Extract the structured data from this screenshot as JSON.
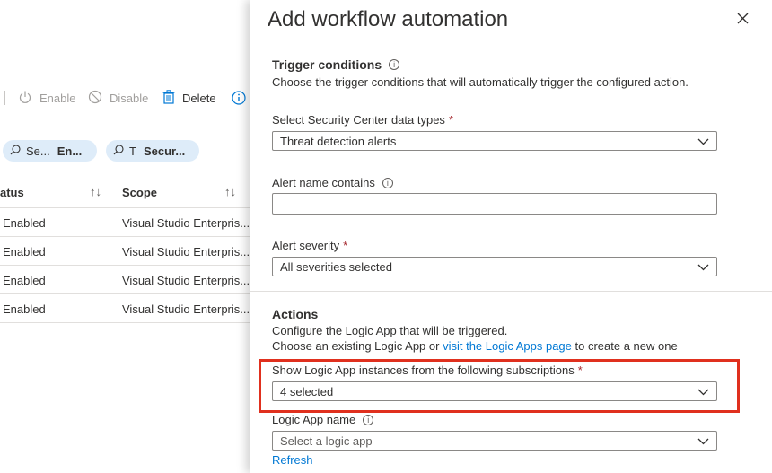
{
  "toolbar": {
    "enable_label": "Enable",
    "disable_label": "Disable",
    "delete_label": "Delete"
  },
  "filters": [
    {
      "label": "Se...",
      "value": "En..."
    },
    {
      "label": "T",
      "value": "Secur..."
    }
  ],
  "table": {
    "columns": [
      "atus",
      "Scope"
    ],
    "rows": [
      {
        "status": "Enabled",
        "scope": "Visual Studio Enterpris..."
      },
      {
        "status": "Enabled",
        "scope": "Visual Studio Enterpris..."
      },
      {
        "status": "Enabled",
        "scope": "Visual Studio Enterpris..."
      },
      {
        "status": "Enabled",
        "scope": "Visual Studio Enterpris..."
      }
    ]
  },
  "blade": {
    "title": "Add workflow automation",
    "trigger": {
      "title": "Trigger conditions",
      "description": "Choose the trigger conditions that will automatically trigger the configured action.",
      "data_types_label": "Select Security Center data types",
      "data_types_value": "Threat detection alerts",
      "alert_name_label": "Alert name contains",
      "alert_name_value": "",
      "severity_label": "Alert severity",
      "severity_value": "All severities selected"
    },
    "actions": {
      "title": "Actions",
      "description_line1": "Configure the Logic App that will be triggered.",
      "description_line2_prefix": "Choose an existing Logic App or ",
      "description_line2_link": "visit the Logic Apps page",
      "description_line2_suffix": " to create a new one",
      "subscriptions_label": "Show Logic App instances from the following subscriptions",
      "subscriptions_value": "4 selected",
      "logic_app_label": "Logic App name",
      "logic_app_placeholder": "Select a logic app",
      "refresh_label": "Refresh"
    }
  },
  "colors": {
    "accent": "#0078d4",
    "required": "#a4262c",
    "highlight": "#e0301e",
    "chip_bg": "#deecf9"
  }
}
